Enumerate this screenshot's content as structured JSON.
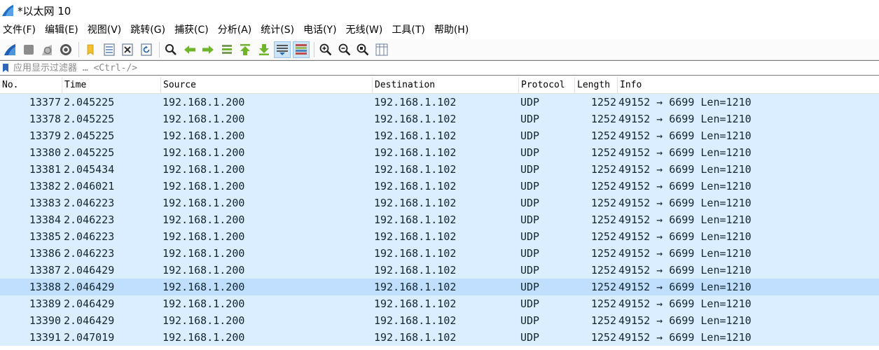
{
  "window": {
    "title": "*以太网 10"
  },
  "menu": [
    "文件(F)",
    "编辑(E)",
    "视图(V)",
    "跳转(G)",
    "捕获(C)",
    "分析(A)",
    "统计(S)",
    "电话(Y)",
    "无线(W)",
    "工具(T)",
    "帮助(H)"
  ],
  "toolbar": {
    "buttons": [
      "start-capture-icon",
      "stop-capture-icon",
      "restart-capture-icon",
      "capture-options-icon",
      "open-file-icon",
      "save-file-icon",
      "close-file-icon",
      "reload-file-icon",
      "find-packet-icon",
      "go-back-icon",
      "go-forward-icon",
      "go-to-packet-icon",
      "go-first-icon",
      "go-last-icon",
      "auto-scroll-icon",
      "colorize-icon",
      "zoom-in-icon",
      "zoom-out-icon",
      "zoom-normal-icon",
      "resize-columns-icon"
    ]
  },
  "filter": {
    "placeholder": "应用显示过滤器 … <Ctrl-/>"
  },
  "columns": [
    "No.",
    "Time",
    "Source",
    "Destination",
    "Protocol",
    "Length",
    "Info"
  ],
  "selected_no": "13388",
  "rows": [
    [
      "13377",
      "2.045225",
      "192.168.1.200",
      "192.168.1.102",
      "UDP",
      "1252",
      "49152 → 6699 Len=1210"
    ],
    [
      "13378",
      "2.045225",
      "192.168.1.200",
      "192.168.1.102",
      "UDP",
      "1252",
      "49152 → 6699 Len=1210"
    ],
    [
      "13379",
      "2.045225",
      "192.168.1.200",
      "192.168.1.102",
      "UDP",
      "1252",
      "49152 → 6699 Len=1210"
    ],
    [
      "13380",
      "2.045225",
      "192.168.1.200",
      "192.168.1.102",
      "UDP",
      "1252",
      "49152 → 6699 Len=1210"
    ],
    [
      "13381",
      "2.045434",
      "192.168.1.200",
      "192.168.1.102",
      "UDP",
      "1252",
      "49152 → 6699 Len=1210"
    ],
    [
      "13382",
      "2.046021",
      "192.168.1.200",
      "192.168.1.102",
      "UDP",
      "1252",
      "49152 → 6699 Len=1210"
    ],
    [
      "13383",
      "2.046223",
      "192.168.1.200",
      "192.168.1.102",
      "UDP",
      "1252",
      "49152 → 6699 Len=1210"
    ],
    [
      "13384",
      "2.046223",
      "192.168.1.200",
      "192.168.1.102",
      "UDP",
      "1252",
      "49152 → 6699 Len=1210"
    ],
    [
      "13385",
      "2.046223",
      "192.168.1.200",
      "192.168.1.102",
      "UDP",
      "1252",
      "49152 → 6699 Len=1210"
    ],
    [
      "13386",
      "2.046223",
      "192.168.1.200",
      "192.168.1.102",
      "UDP",
      "1252",
      "49152 → 6699 Len=1210"
    ],
    [
      "13387",
      "2.046429",
      "192.168.1.200",
      "192.168.1.102",
      "UDP",
      "1252",
      "49152 → 6699 Len=1210"
    ],
    [
      "13388",
      "2.046429",
      "192.168.1.200",
      "192.168.1.102",
      "UDP",
      "1252",
      "49152 → 6699 Len=1210"
    ],
    [
      "13389",
      "2.046429",
      "192.168.1.200",
      "192.168.1.102",
      "UDP",
      "1252",
      "49152 → 6699 Len=1210"
    ],
    [
      "13390",
      "2.046429",
      "192.168.1.200",
      "192.168.1.102",
      "UDP",
      "1252",
      "49152 → 6699 Len=1210"
    ],
    [
      "13391",
      "2.047019",
      "192.168.1.200",
      "192.168.1.102",
      "UDP",
      "1252",
      "49152 → 6699 Len=1210"
    ]
  ]
}
